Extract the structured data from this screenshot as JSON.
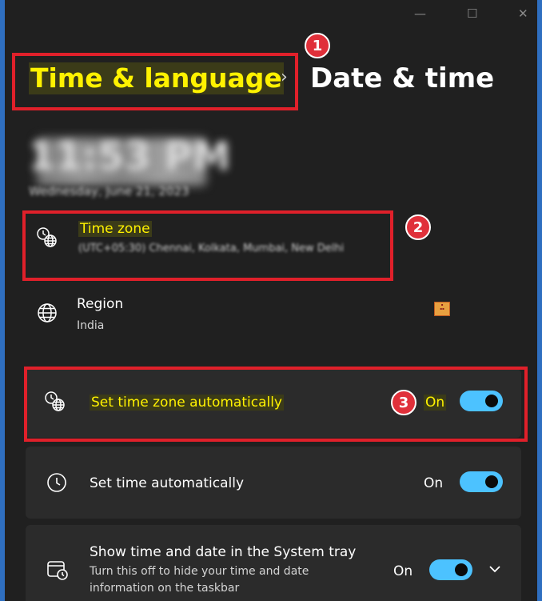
{
  "window": {
    "controls": {
      "minimize": "—",
      "maximize": "☐",
      "close": "✕"
    }
  },
  "breadcrumb": {
    "parent": "Time & language",
    "separator": "›",
    "current": "Date & time"
  },
  "clock": {
    "time": "11:53 PM",
    "date": "Wednesday, June 21, 2023"
  },
  "timezone": {
    "title": "Time zone",
    "value": "(UTC+05:30) Chennai, Kolkata, Mumbai, New Delhi"
  },
  "region": {
    "title": "Region",
    "value": "India"
  },
  "settings": {
    "auto_timezone": {
      "label": "Set time zone automatically",
      "state": "On"
    },
    "auto_time": {
      "label": "Set time automatically",
      "state": "On"
    },
    "system_tray": {
      "label": "Show time and date in the System tray",
      "description_line1": "Turn this off to hide your time and date",
      "description_line2": "information on the taskbar",
      "state": "On"
    }
  },
  "annotations": {
    "badge1": "1",
    "badge2": "2",
    "badge3": "3"
  },
  "colors": {
    "accent": "#4cc2ff",
    "highlight": "#fff200",
    "annotation_red": "#e0202a"
  }
}
